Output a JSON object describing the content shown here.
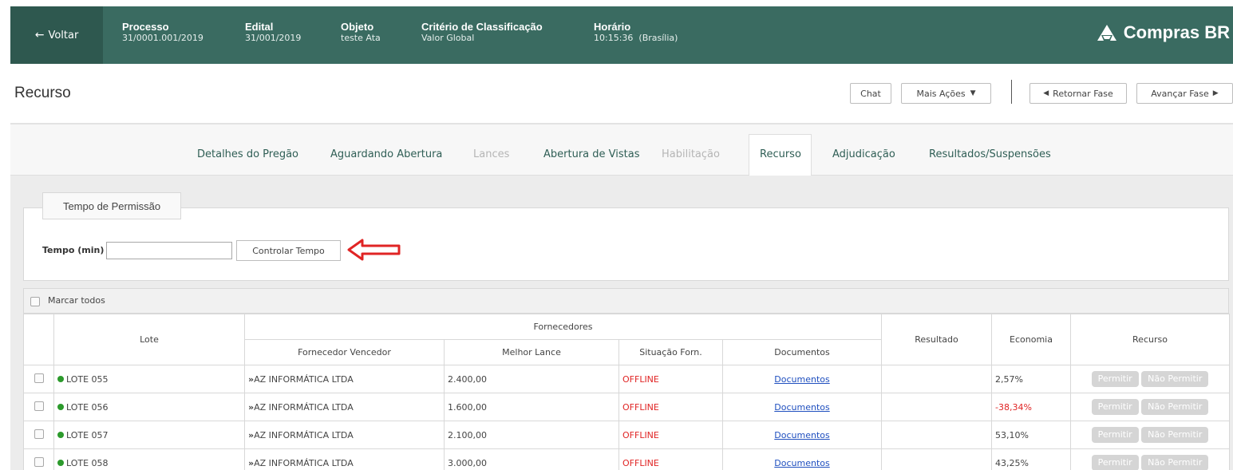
{
  "header": {
    "back_label": "Voltar",
    "fields": [
      {
        "label": "Processo",
        "value": "31/0001.001/2019"
      },
      {
        "label": "Edital",
        "value": "31/001/2019"
      },
      {
        "label": "Objeto",
        "value": "teste Ata"
      },
      {
        "label": "Critério de Classificação",
        "value": "Valor Global"
      },
      {
        "label": "Horário",
        "value": "10:15:36  (Brasília)"
      }
    ],
    "brand": "Compras BR"
  },
  "page": {
    "title": "Recurso",
    "chat_label": "Chat",
    "more_actions_label": "Mais Ações",
    "return_phase_label": "Retornar Fase",
    "advance_phase_label": "Avançar Fase"
  },
  "tabs": [
    {
      "label": "Detalhes do Pregão",
      "state": "enabled"
    },
    {
      "label": "Aguardando Abertura",
      "state": "enabled"
    },
    {
      "label": "Lances",
      "state": "disabled"
    },
    {
      "label": "Abertura de Vistas",
      "state": "enabled"
    },
    {
      "label": "Habilitação",
      "state": "disabled"
    },
    {
      "label": "Recurso",
      "state": "active"
    },
    {
      "label": "Adjudicação",
      "state": "enabled"
    },
    {
      "label": "Resultados/Suspensões",
      "state": "enabled"
    }
  ],
  "permission": {
    "legend": "Tempo de Permissão",
    "time_label": "Tempo (min)",
    "time_value": "",
    "control_button": "Controlar Tempo"
  },
  "table": {
    "mark_all_label": "Marcar todos",
    "headers": {
      "lote": "Lote",
      "fornecedores": "Fornecedores",
      "fornecedor_vencedor": "Fornecedor Vencedor",
      "melhor_lance": "Melhor Lance",
      "situacao": "Situação Forn.",
      "documentos": "Documentos",
      "resultado": "Resultado",
      "economia": "Economia",
      "recurso": "Recurso"
    },
    "rows": [
      {
        "lote": "LOTE 055",
        "fornecedor": "AZ INFORMÁTICA LTDA",
        "lance": "2.400,00",
        "situacao": "OFFLINE",
        "documentos": "Documentos",
        "resultado": "",
        "economia": "2,57%",
        "permitir": "Permitir",
        "nao_permitir": "Não Permitir"
      },
      {
        "lote": "LOTE 056",
        "fornecedor": "AZ INFORMÁTICA LTDA",
        "lance": "1.600,00",
        "situacao": "OFFLINE",
        "documentos": "Documentos",
        "resultado": "",
        "economia": "-38,34%",
        "permitir": "Permitir",
        "nao_permitir": "Não Permitir"
      },
      {
        "lote": "LOTE 057",
        "fornecedor": "AZ INFORMÁTICA LTDA",
        "lance": "2.100,00",
        "situacao": "OFFLINE",
        "documentos": "Documentos",
        "resultado": "",
        "economia": "53,10%",
        "permitir": "Permitir",
        "nao_permitir": "Não Permitir"
      },
      {
        "lote": "LOTE 058",
        "fornecedor": "AZ INFORMÁTICA LTDA",
        "lance": "3.000,00",
        "situacao": "OFFLINE",
        "documentos": "Documentos",
        "resultado": "",
        "economia": "43,25%",
        "permitir": "Permitir",
        "nao_permitir": "Não Permitir"
      }
    ]
  },
  "colors": {
    "header_bg": "#3a6b61",
    "back_bg": "#2e584f",
    "tab_text": "#2f5e55",
    "offline": "#e02424",
    "status_dot": "#2c9a2c",
    "arrow": "#e02424"
  }
}
